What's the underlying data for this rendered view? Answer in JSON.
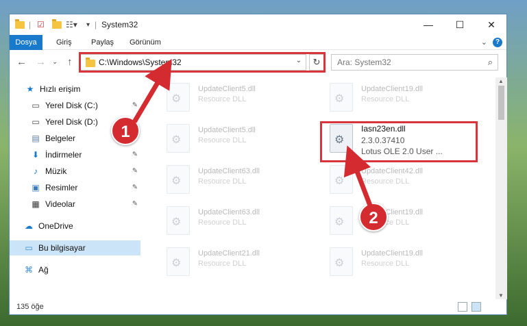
{
  "window": {
    "title": "System32",
    "controls": {
      "minimize": "—",
      "maximize": "☐",
      "close": "✕"
    }
  },
  "ribbon": {
    "tabs": [
      "Dosya",
      "Giriş",
      "Paylaş",
      "Görünüm"
    ],
    "help": "?"
  },
  "navbar": {
    "address_path": "C:\\Windows\\System32",
    "search_placeholder": "Ara: System32"
  },
  "sidebar": {
    "items": [
      {
        "label": "Hızlı erişim",
        "icon": "star-icon"
      },
      {
        "label": "Yerel Disk (C:)",
        "icon": "drive-icon"
      },
      {
        "label": "Yerel Disk (D:)",
        "icon": "drive-icon"
      },
      {
        "label": "Belgeler",
        "icon": "document-icon"
      },
      {
        "label": "İndirmeler",
        "icon": "download-icon"
      },
      {
        "label": "Müzik",
        "icon": "music-icon"
      },
      {
        "label": "Resimler",
        "icon": "pictures-icon"
      },
      {
        "label": "Videolar",
        "icon": "video-icon"
      },
      {
        "label": "OneDrive",
        "icon": "cloud-icon"
      },
      {
        "label": "Bu bilgisayar",
        "icon": "computer-icon"
      },
      {
        "label": "Ağ",
        "icon": "network-icon"
      }
    ]
  },
  "files": {
    "col1": [
      {
        "name": "UpdateClient5.dll",
        "desc": "Resource DLL"
      },
      {
        "name": "UpdateClient5.dll",
        "desc": "Resource DLL"
      },
      {
        "name": "UpdateClient63.dll",
        "desc": "Resource DLL"
      },
      {
        "name": "UpdateClient63.dll",
        "desc": "Resource DLL"
      },
      {
        "name": "UpdateClient21.dll",
        "desc": "Resource DLL"
      }
    ],
    "col2": [
      {
        "name": "UpdateClient19.dll",
        "desc": "Resource DLL"
      },
      {
        "name": "UpdateClient42.dll",
        "desc": "Resource DLL"
      },
      {
        "name": "UpdateClient19.dll",
        "desc": "Resource DLL"
      },
      {
        "name": "UpdateClient19.dll",
        "desc": "Resource DLL"
      }
    ],
    "focus": {
      "name": "Iasn23en.dll",
      "version": "2.3.0.37410",
      "desc": "Lotus OLE 2.0 User ..."
    }
  },
  "status": {
    "count": "135 öğe"
  },
  "badges": {
    "one": "1",
    "two": "2"
  },
  "colors": {
    "accent": "#1979ca",
    "highlight": "#d9333b"
  }
}
